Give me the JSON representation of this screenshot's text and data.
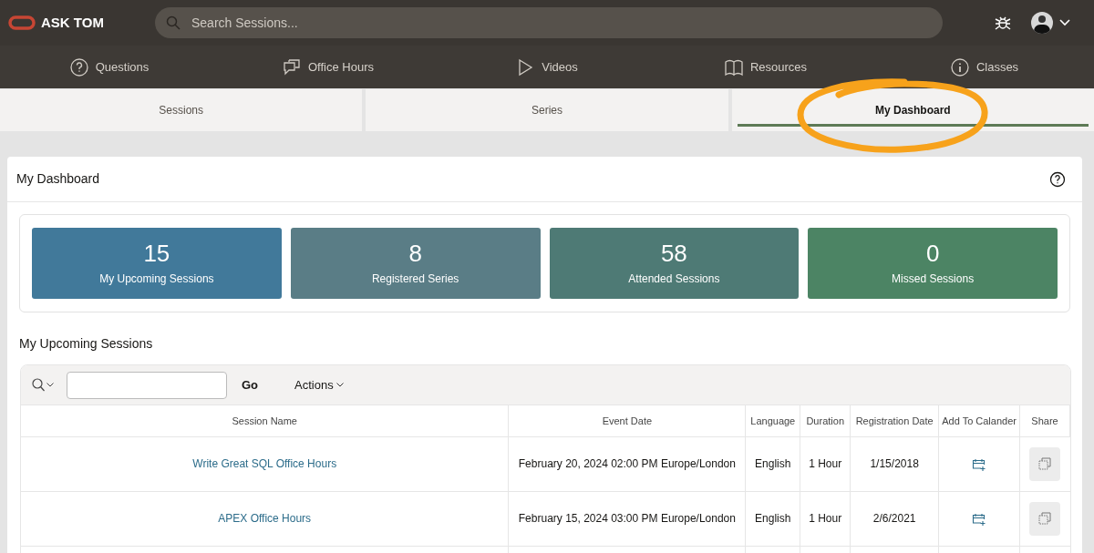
{
  "header": {
    "logo_text": "ASK TOM",
    "search": {
      "placeholder": "Search Sessions..."
    }
  },
  "nav": [
    {
      "label": "Questions",
      "kind": "question"
    },
    {
      "label": "Office Hours",
      "kind": "chat"
    },
    {
      "label": "Videos",
      "kind": "play"
    },
    {
      "label": "Resources",
      "kind": "book"
    },
    {
      "label": "Classes",
      "kind": "info"
    }
  ],
  "tabs": [
    {
      "label": "Sessions",
      "selected": false
    },
    {
      "label": "Series",
      "selected": false
    },
    {
      "label": "My Dashboard",
      "selected": true
    }
  ],
  "dashboard": {
    "title": "My Dashboard",
    "stats": [
      {
        "value": "15",
        "label": "My Upcoming Sessions",
        "color": "#41799a"
      },
      {
        "value": "8",
        "label": "Registered Series",
        "color": "#5a7d86"
      },
      {
        "value": "58",
        "label": "Attended Sessions",
        "color": "#4e7a75"
      },
      {
        "value": "0",
        "label": "Missed Sessions",
        "color": "#4c8464"
      }
    ]
  },
  "report": {
    "title": "My Upcoming Sessions",
    "go": "Go",
    "actions": "Actions",
    "columns": [
      "Session Name",
      "Event Date",
      "Language",
      "Duration",
      "Registration Date",
      "Add To Calander",
      "Share"
    ],
    "rows": [
      {
        "session_name": "Write Great SQL Office Hours",
        "event_date": "February 20, 2024 02:00 PM Europe/London",
        "language": "English",
        "duration": "1 Hour",
        "registration_date": "1/15/2018"
      },
      {
        "session_name": "APEX Office Hours",
        "event_date": "February 15, 2024 03:00 PM Europe/London",
        "language": "English",
        "duration": "1 Hour",
        "registration_date": "2/6/2021"
      }
    ]
  }
}
